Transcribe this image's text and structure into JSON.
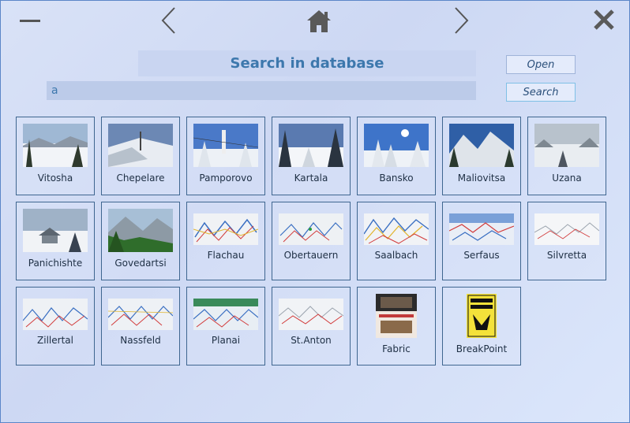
{
  "titlebar": {
    "minimize_icon": "minimize-icon",
    "back_icon": "chevron-left-icon",
    "home_icon": "home-icon",
    "forward_icon": "chevron-right-icon",
    "close_icon": "close-icon"
  },
  "search": {
    "title": "Search in database",
    "query": "a",
    "open_label": "Open",
    "search_label": "Search"
  },
  "results": [
    {
      "label": "Vitosha",
      "kind": "photo"
    },
    {
      "label": "Chepelare",
      "kind": "photo"
    },
    {
      "label": "Pamporovo",
      "kind": "photo"
    },
    {
      "label": "Kartala",
      "kind": "photo"
    },
    {
      "label": "Bansko",
      "kind": "photo"
    },
    {
      "label": "Maliovitsa",
      "kind": "photo"
    },
    {
      "label": "Uzana",
      "kind": "photo"
    },
    {
      "label": "Panichishte",
      "kind": "photo"
    },
    {
      "label": "Govedartsi",
      "kind": "photo"
    },
    {
      "label": "Flachau",
      "kind": "map"
    },
    {
      "label": "Obertauern",
      "kind": "map"
    },
    {
      "label": "Saalbach",
      "kind": "map"
    },
    {
      "label": "Serfaus",
      "kind": "map"
    },
    {
      "label": "Silvretta",
      "kind": "map"
    },
    {
      "label": "Zillertal",
      "kind": "map"
    },
    {
      "label": "Nassfeld",
      "kind": "map"
    },
    {
      "label": "Planai",
      "kind": "map"
    },
    {
      "label": "St.Anton",
      "kind": "map"
    },
    {
      "label": "Fabric",
      "kind": "poster"
    },
    {
      "label": "BreakPoint",
      "kind": "poster2"
    }
  ]
}
